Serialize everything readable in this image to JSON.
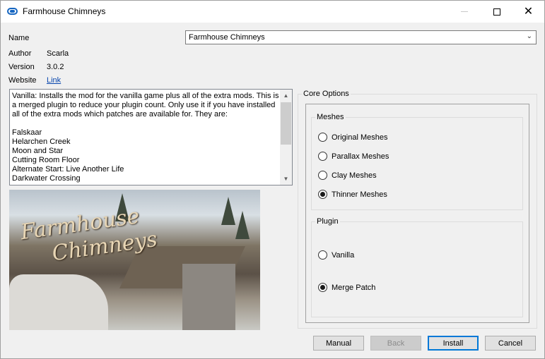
{
  "window": {
    "title": "Farmhouse Chimneys"
  },
  "fields": {
    "name_label": "Name",
    "author_label": "Author",
    "author_value": "Scarla",
    "version_label": "Version",
    "version_value": "3.0.2",
    "website_label": "Website",
    "website_link": "Link"
  },
  "name_select": {
    "value": "Farmhouse Chimneys"
  },
  "description": "Vanilla: Installs the mod for the vanilla game plus all of the extra mods. This is\na merged plugin to reduce your plugin count. Only use it if you have installed\nall of the extra mods which patches are available for. They are:\n\nFalskaar\nHelarchen Creek\nMoon and Star\nCutting Room Floor\nAlternate Start: Live Another Life\nDarkwater Crossing",
  "preview": {
    "logo_line1": "Farmhouse",
    "logo_line2": "Chimneys"
  },
  "core_options": {
    "title": "Core Options",
    "meshes": {
      "title": "Meshes",
      "options": [
        {
          "label": "Original Meshes",
          "selected": false
        },
        {
          "label": "Parallax Meshes",
          "selected": false
        },
        {
          "label": "Clay Meshes",
          "selected": false
        },
        {
          "label": "Thinner Meshes",
          "selected": true
        }
      ]
    },
    "plugin": {
      "title": "Plugin",
      "options": [
        {
          "label": "Vanilla",
          "selected": false
        },
        {
          "label": "Merge Patch",
          "selected": true
        }
      ]
    }
  },
  "buttons": {
    "manual": "Manual",
    "back": "Back",
    "install": "Install",
    "cancel": "Cancel"
  }
}
